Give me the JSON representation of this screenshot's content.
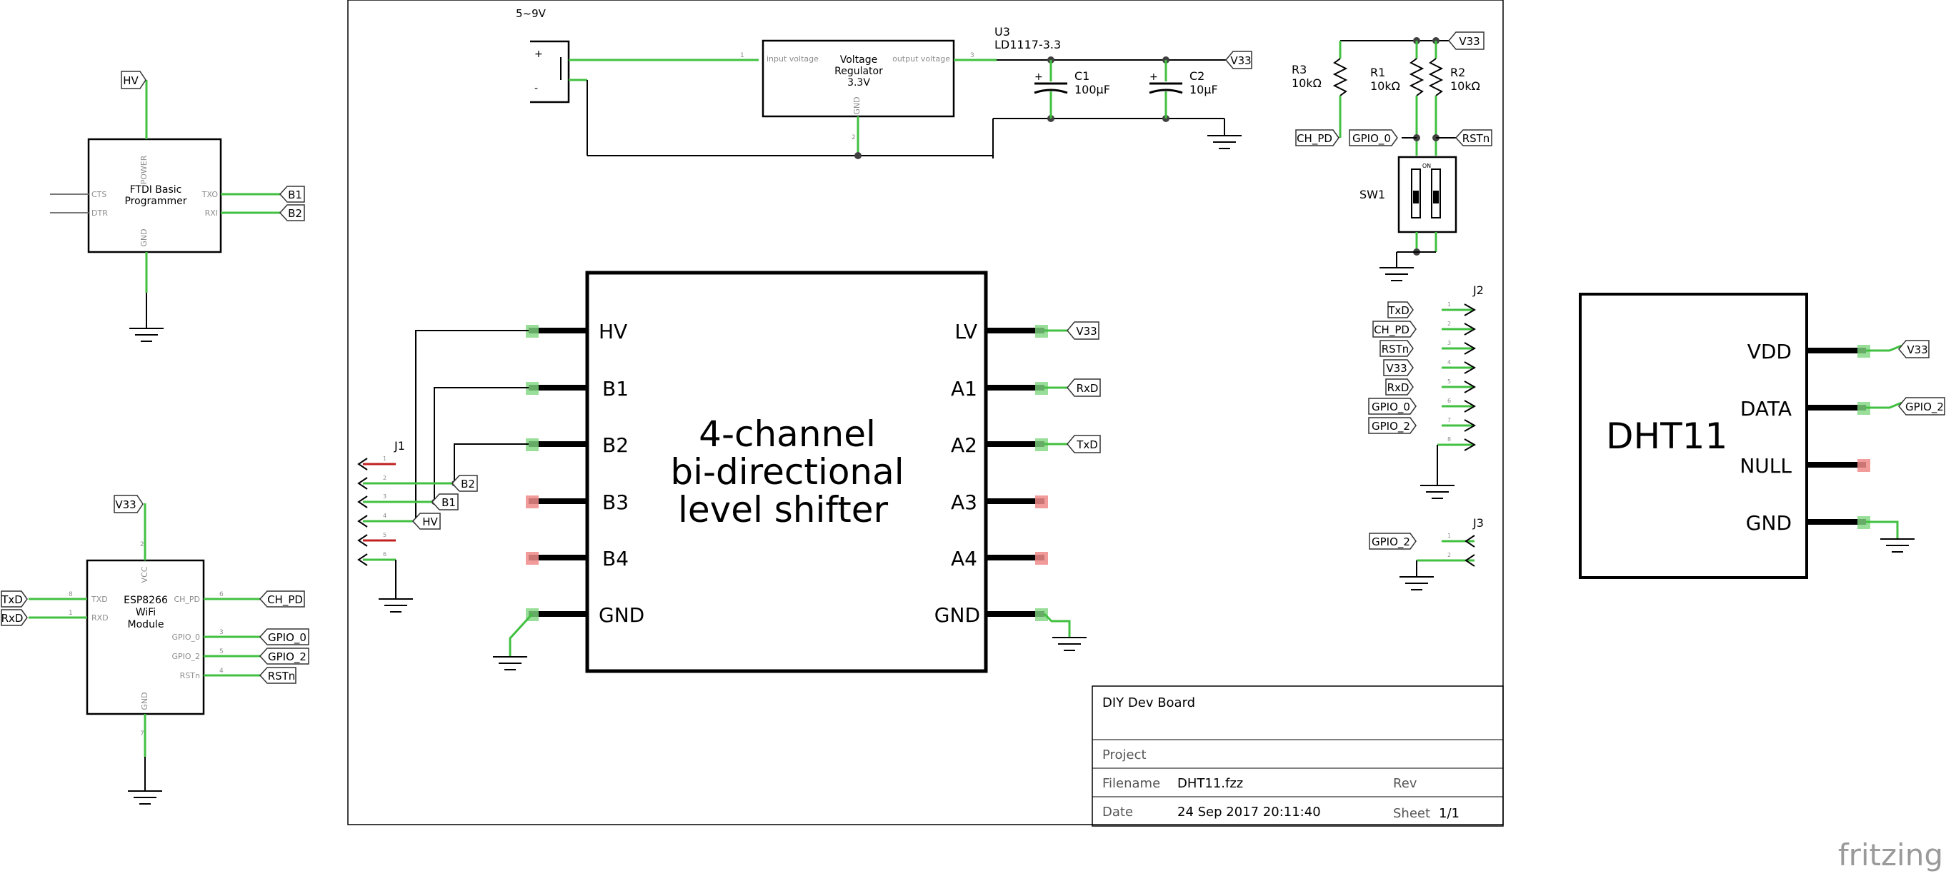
{
  "supply": {
    "label": "5~9V"
  },
  "regulator": {
    "ref": "U3",
    "part": "LD1117-3.3",
    "title": [
      "Voltage",
      "Regulator",
      "3.3V"
    ],
    "pin_in": "input voltage",
    "pin_out": "output voltage",
    "pin_gnd": "GND",
    "pin_in_num": "1",
    "pin_out_num": "3",
    "pin_gnd_num": "2"
  },
  "caps": [
    {
      "ref": "C1",
      "value": "100µF"
    },
    {
      "ref": "C2",
      "value": "10µF"
    }
  ],
  "resistors": [
    {
      "ref": "R3",
      "value": "10kΩ"
    },
    {
      "ref": "R1",
      "value": "10kΩ"
    },
    {
      "ref": "R2",
      "value": "10kΩ"
    }
  ],
  "switch": {
    "ref": "SW1",
    "on": "ON"
  },
  "ftdi": {
    "title": [
      "FTDI Basic",
      "Programmer"
    ],
    "pins": [
      "CTS",
      "DTR",
      "TXO",
      "RXI",
      "POWER",
      "GND"
    ]
  },
  "esp": {
    "title": [
      "ESP8266",
      "WiFi",
      "Module"
    ],
    "pins": [
      "TXD",
      "RXD",
      "VCC",
      "GND",
      "CH_PD",
      "GPIO_0",
      "GPIO_2",
      "RSTn"
    ],
    "nums": [
      "8",
      "1",
      "2",
      "7",
      "6",
      "3",
      "5",
      "4"
    ]
  },
  "shifter": {
    "title": [
      "4-channel",
      "bi-directional",
      "level shifter"
    ],
    "left": [
      "HV",
      "B1",
      "B2",
      "B3",
      "B4",
      "GND"
    ],
    "right": [
      "LV",
      "A1",
      "A2",
      "A3",
      "A4",
      "GND"
    ]
  },
  "dht": {
    "title": "DHT11",
    "pins": [
      "VDD",
      "DATA",
      "NULL",
      "GND"
    ]
  },
  "j1": {
    "ref": "J1",
    "nums": [
      "1",
      "2",
      "3",
      "4",
      "5",
      "6"
    ]
  },
  "j2": {
    "ref": "J2",
    "nums": [
      "1",
      "2",
      "3",
      "4",
      "5",
      "6",
      "7",
      "8"
    ]
  },
  "j3": {
    "ref": "J3",
    "nums": [
      "1",
      "2"
    ]
  },
  "nets": {
    "HV": "HV",
    "B1": "B1",
    "B2": "B2",
    "V33": "V33",
    "TxD": "TxD",
    "RxD": "RxD",
    "CH_PD": "CH_PD",
    "GPIO_0": "GPIO_0",
    "GPIO_2": "GPIO_2",
    "RSTn": "RSTn"
  },
  "titleblock": {
    "name": "DIY Dev Board",
    "project_label": "Project",
    "filename_label": "Filename",
    "filename": "DHT11.fzz",
    "rev_label": "Rev",
    "date_label": "Date",
    "date": "24 Sep 2017 20:11:40",
    "sheet_label": "Sheet",
    "sheet": "1/1"
  },
  "brand": "fritzing",
  "colors": {
    "wire": "#000000",
    "connected_pin": "#41c041",
    "unconnected_pin": "#f08a8a"
  }
}
